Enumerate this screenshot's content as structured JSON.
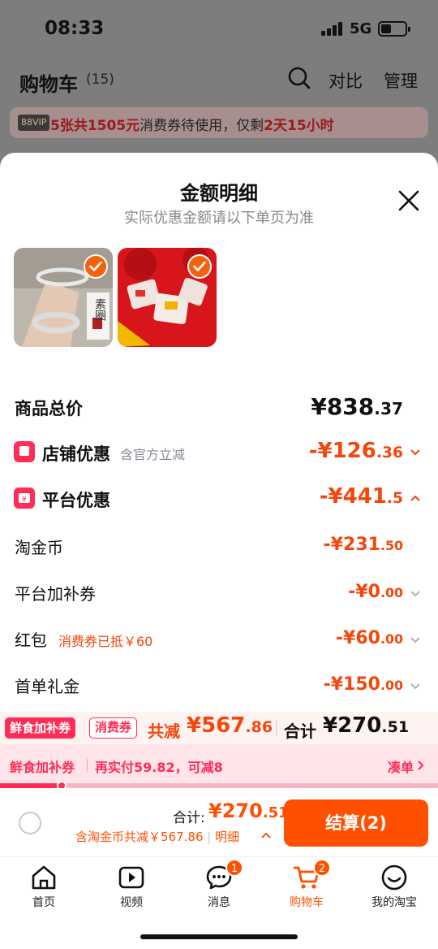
{
  "status": {
    "time": "08:33",
    "network": "5G"
  },
  "cart_header": {
    "title": "购物车",
    "count": "(15)",
    "compare": "对比",
    "manage": "管理"
  },
  "vip_banner": {
    "tag": "88VIP",
    "prefix": "5张共1505元",
    "middle": "消费券待使用，仅剩",
    "remaining": "2天15小时"
  },
  "sheet": {
    "title": "金额明细",
    "subtitle": "实际优惠金额请以下单页为准",
    "items": [
      {
        "name": "bracelet",
        "badge": "素圈"
      },
      {
        "name": "candy-pack"
      }
    ],
    "total": {
      "label": "商品总价",
      "int": "¥838",
      "dec": ".37"
    },
    "shop_discount": {
      "label": "店铺优惠",
      "hint": "含官方立减",
      "int": "-¥126",
      "dec": ".36"
    },
    "platform_discount": {
      "label": "平台优惠",
      "int": "-¥441",
      "dec": ".5"
    },
    "taojinbi": {
      "label": "淘金币",
      "int": "-¥231",
      "dec": ".50"
    },
    "subsidy": {
      "label": "平台加补券",
      "int": "-¥0",
      "dec": ".00"
    },
    "hongbao": {
      "label": "红包",
      "hint": "消费券已抵￥60",
      "int": "-¥60",
      "dec": ".00"
    },
    "first_order": {
      "label": "首单礼金",
      "int": "-¥150",
      "dec": ".00"
    }
  },
  "promo": {
    "tag1": "鲜食加补券",
    "tag2": "消费券",
    "reduce_label": "共减",
    "reduce_int": "¥567",
    "reduce_dec": ".86",
    "total_label": "合计",
    "total_int": "¥270",
    "total_dec": ".51",
    "bar_title": "鲜食加补券",
    "bar_text": "再实付59.82，可减8",
    "bar_action": "凑单",
    "progress": 0.14
  },
  "checkout": {
    "sum_label": "合计:",
    "sum_int": "¥270",
    "sum_dec": ".51",
    "detail_text": "含淘金币共减￥567.86",
    "detail_link": "明细",
    "pay_label": "结算(2)"
  },
  "tabbar": [
    {
      "label": "首页",
      "icon": "home-icon"
    },
    {
      "label": "视频",
      "icon": "video-icon"
    },
    {
      "label": "消息",
      "icon": "message-icon",
      "badge": "1"
    },
    {
      "label": "购物车",
      "icon": "cart-icon",
      "badge": "2",
      "active": true
    },
    {
      "label": "我的淘宝",
      "icon": "smile-icon"
    }
  ],
  "colors": {
    "accent": "#ff5000",
    "discount": "#f2470d",
    "pink": "#ff2d55"
  }
}
